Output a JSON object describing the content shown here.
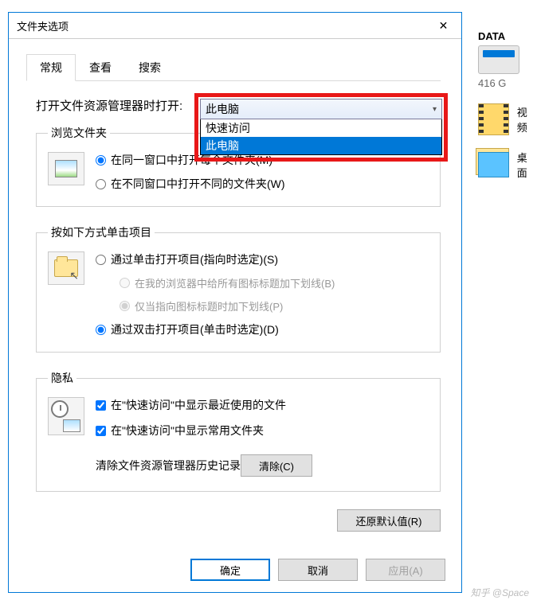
{
  "dialog": {
    "title": "文件夹选项",
    "tabs": [
      "常规",
      "查看",
      "搜索"
    ],
    "open_label": "打开文件资源管理器时打开:",
    "combo": {
      "selected": "此电脑",
      "options": [
        "快速访问",
        "此电脑"
      ]
    },
    "browse": {
      "legend": "浏览文件夹",
      "radio1": "在同一窗口中打开每个文件夹(M)",
      "radio2": "在不同窗口中打开不同的文件夹(W)"
    },
    "click": {
      "legend": "按如下方式单击项目",
      "radio1": "通过单击打开项目(指向时选定)(S)",
      "sub1": "在我的浏览器中给所有图标标题加下划线(B)",
      "sub2": "仅当指向图标标题时加下划线(P)",
      "radio2": "通过双击打开项目(单击时选定)(D)"
    },
    "privacy": {
      "legend": "隐私",
      "check1": "在\"快速访问\"中显示最近使用的文件",
      "check2": "在\"快速访问\"中显示常用文件夹",
      "clear_label": "清除文件资源管理器历史记录",
      "clear_btn": "清除(C)"
    },
    "restore_btn": "还原默认值(R)",
    "ok": "确定",
    "cancel": "取消",
    "apply": "应用(A)"
  },
  "side": {
    "drive_label": "DATA",
    "drive_sub": "416 G",
    "video": "视频",
    "desktop": "桌面"
  },
  "watermark": "知乎 @Space"
}
